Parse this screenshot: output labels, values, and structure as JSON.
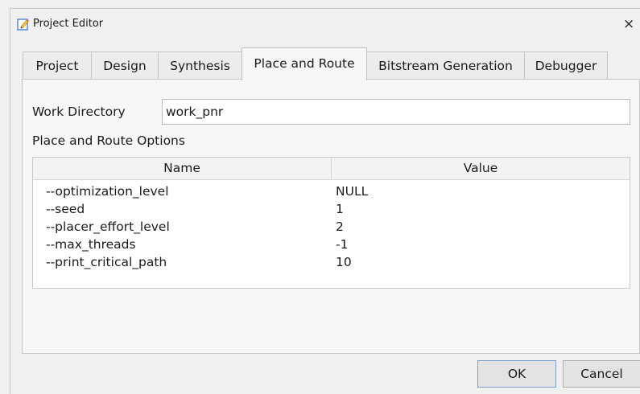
{
  "window": {
    "title": "Project Editor",
    "close_glyph": "×",
    "icon": "edit-document-icon"
  },
  "tabs": [
    {
      "label": "Project",
      "active": false
    },
    {
      "label": "Design",
      "active": false
    },
    {
      "label": "Synthesis",
      "active": false
    },
    {
      "label": "Place and Route",
      "active": true
    },
    {
      "label": "Bitstream Generation",
      "active": false
    },
    {
      "label": "Debugger",
      "active": false
    }
  ],
  "work_directory": {
    "label": "Work Directory",
    "value": "work_pnr"
  },
  "options": {
    "label": "Place and Route Options",
    "columns": [
      "Name",
      "Value"
    ],
    "rows": [
      {
        "name": "--optimization_level",
        "value": "NULL"
      },
      {
        "name": "--seed",
        "value": "1"
      },
      {
        "name": "--placer_effort_level",
        "value": "2"
      },
      {
        "name": "--max_threads",
        "value": "-1"
      },
      {
        "name": "--print_critical_path",
        "value": "10"
      }
    ]
  },
  "buttons": {
    "ok": "OK",
    "cancel": "Cancel"
  },
  "colors": {
    "window_bg": "#f0f0f0",
    "panel_bg": "#f7f7f7",
    "default_button_border": "#7a9ed0"
  }
}
